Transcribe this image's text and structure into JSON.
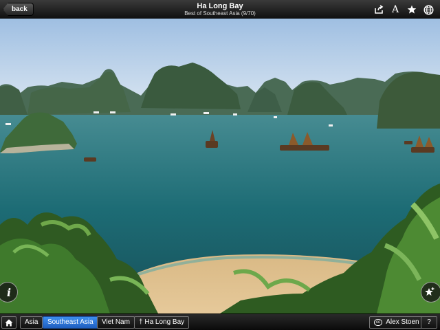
{
  "header": {
    "back_label": "back",
    "title": "Ha Long Bay",
    "subtitle": "Best of Southeast Asia (9/70)",
    "icons": [
      "share-icon",
      "font-size-icon",
      "star-icon",
      "globe-icon"
    ],
    "font_icon_glyph": "A"
  },
  "overlay": {
    "info_glyph": "i",
    "info_icon": "info-icon",
    "favorite_icon": "add-favorite-icon"
  },
  "breadcrumbs": {
    "home_icon": "home-icon",
    "items": [
      "Asia",
      "Southeast Asia",
      "Viet Nam",
      "Ha Long Bay"
    ],
    "active_index": 1,
    "pin_glyph": "†"
  },
  "credit": {
    "license_glyph": "cc",
    "author": "Alex Stoen",
    "help_label": "?"
  },
  "colors": {
    "active_crumb": "#2f7fe0",
    "bar_dark": "#111111",
    "sea": "#1e6f79",
    "sky": "#c8d9ec"
  }
}
